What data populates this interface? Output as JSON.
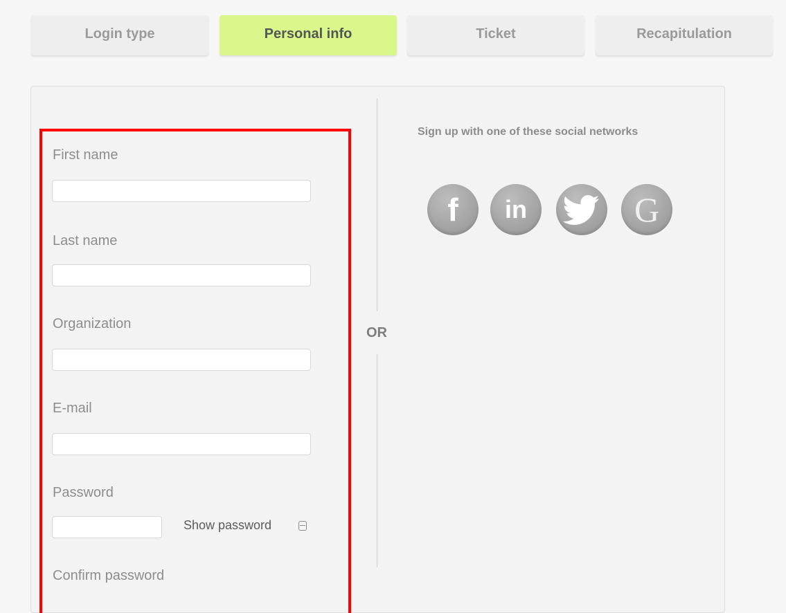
{
  "tabs": [
    {
      "label": "Login type",
      "active": false
    },
    {
      "label": "Personal info",
      "active": true
    },
    {
      "label": "Ticket",
      "active": false
    },
    {
      "label": "Recapitulation",
      "active": false
    }
  ],
  "form": {
    "first_name_label": "First name",
    "first_name_value": "",
    "last_name_label": "Last name",
    "last_name_value": "",
    "organization_label": "Organization",
    "organization_value": "",
    "email_label": "E-mail",
    "email_value": "",
    "password_label": "Password",
    "password_value": "",
    "show_password_label": "Show password",
    "confirm_password_label": "Confirm password"
  },
  "divider": {
    "or_label": "OR"
  },
  "social": {
    "title": "Sign up with one of these social networks",
    "networks": [
      {
        "name": "facebook",
        "icon": "facebook-icon",
        "glyph": "f"
      },
      {
        "name": "linkedin",
        "icon": "linkedin-icon",
        "glyph": "in"
      },
      {
        "name": "twitter",
        "icon": "twitter-icon"
      },
      {
        "name": "google",
        "icon": "google-icon",
        "glyph": "G"
      }
    ]
  },
  "colors": {
    "active_tab": "#d9f78a",
    "highlight": "#ff0000",
    "background": "#f6f6f6"
  }
}
